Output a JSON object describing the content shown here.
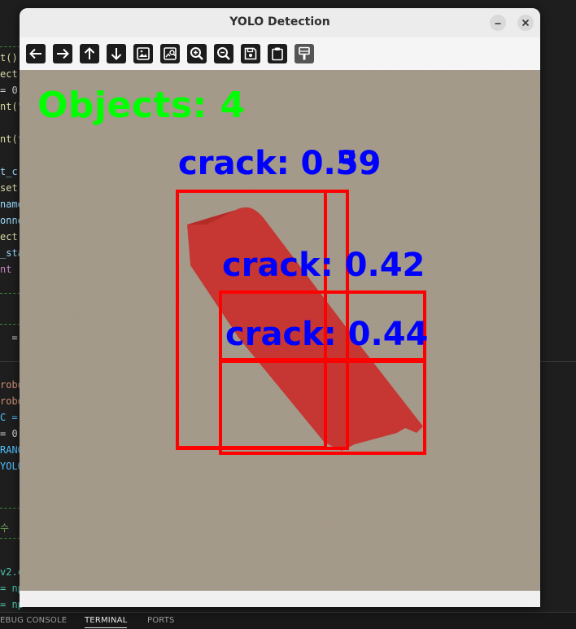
{
  "window": {
    "title": "YOLO Detection",
    "controls": [
      "minimize-icon",
      "close-icon"
    ]
  },
  "toolbar": {
    "buttons": [
      {
        "name": "back-icon"
      },
      {
        "name": "forward-icon"
      },
      {
        "name": "pan-up-icon"
      },
      {
        "name": "pan-down-icon"
      },
      {
        "name": "image-icon"
      },
      {
        "name": "image-search-icon"
      },
      {
        "name": "zoom-in-icon"
      },
      {
        "name": "zoom-out-icon"
      },
      {
        "name": "save-icon"
      },
      {
        "name": "clipboard-icon"
      },
      {
        "name": "paint-brush-icon"
      }
    ]
  },
  "canvas": {
    "background_color": "#a59a89",
    "object_count_text": "Objects: 4",
    "object_count_color": "#00ff00",
    "box_color": "#ff0000",
    "label_color": "#0000ff",
    "detections": [
      {
        "label": "crack: 0.59"
      },
      {
        "label": "crack: 0.39"
      },
      {
        "label": "crack: 0.42"
      },
      {
        "label": "crack: 0.44"
      }
    ]
  },
  "background_editor": {
    "bottom_tabs": [
      "EBUG CONSOLE",
      "TERMINAL",
      "PORTS"
    ],
    "active_tab": "TERMINAL"
  }
}
